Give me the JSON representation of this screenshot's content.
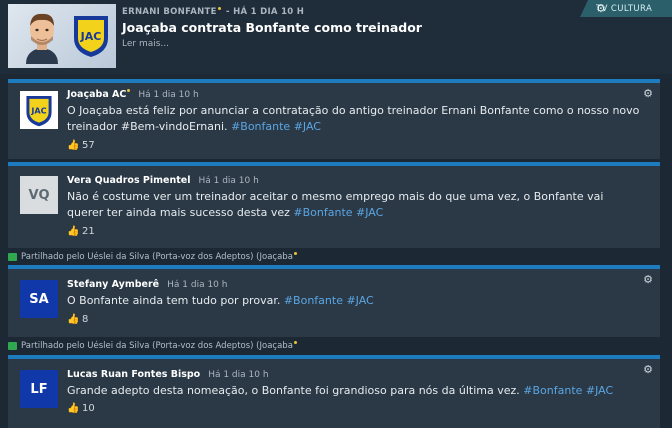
{
  "header": {
    "author": "ERNANI BONFANTE",
    "time": "HÁ 1 DIA 10 H",
    "title": "Joaçaba contrata Bonfante como treinador",
    "read_more": "Ler mais...",
    "channel_tab": "TV CULTURA",
    "crest_text": "JAC"
  },
  "posts": [
    {
      "author": "Joaçaba AC",
      "time": "Há 1 dia 10 h",
      "avatar": "JAC",
      "text": "O Joaçaba está feliz por anunciar a contratação do antigo treinador Ernani Bonfante como o nosso novo treinador #Bem-vindoErnani.",
      "hashtags": "#Bonfante #JAC",
      "likes": "57"
    },
    {
      "author": "Vera Quadros Pimentel",
      "time": "Há 1 dia 10 h",
      "avatar": "VQ",
      "text": "Não é costume ver um treinador aceitar o mesmo emprego mais do que uma vez, o Bonfante vai querer ter ainda mais sucesso desta vez",
      "hashtags": "#Bonfante #JAC",
      "likes": "21"
    },
    {
      "shared_by": "Partilhado pelo Uéslei da Silva (Porta-voz dos Adeptos) (Joaçaba",
      "author": "Stefany Aymberê",
      "time": "Há 1 dia 10 h",
      "avatar": "SA",
      "text": "O Bonfante ainda tem tudo por provar.",
      "hashtags": "#Bonfante #JAC",
      "likes": "8"
    },
    {
      "shared_by": "Partilhado pelo Uéslei da Silva (Porta-voz dos Adeptos) (Joaçaba",
      "author": "Lucas Ruan Fontes Bispo",
      "time": "Há 1 dia 10 h",
      "avatar": "LF",
      "text": "Grande adepto desta nomeação, o Bonfante foi grandioso para nós da última vez.",
      "hashtags": "#Bonfante #JAC",
      "likes": "10"
    }
  ],
  "colors": {
    "accent": "#1e7bbd",
    "hashtag": "#5aa6e3",
    "card": "#2b3946",
    "background": "#1c2834",
    "tab": "#2b5f6a",
    "shared_icon": "#2fa84f"
  }
}
